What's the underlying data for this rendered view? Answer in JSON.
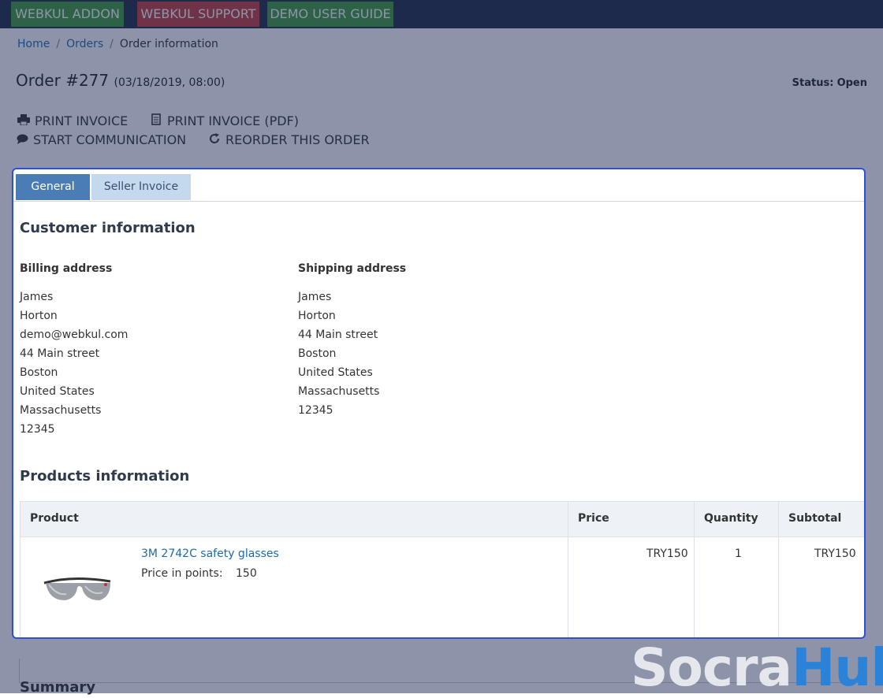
{
  "topbar": {
    "addon_label": "WEBKUL ADDON",
    "support_label": "WEBKUL SUPPORT",
    "guide_label": "DEMO USER GUIDE"
  },
  "breadcrumb": [
    "Home",
    "Orders",
    "Order information"
  ],
  "breadcrumb_sep": "/",
  "order": {
    "title": "Order #277",
    "date": "(03/18/2019, 08:00)",
    "status_label": "Status:",
    "status_value": "Open"
  },
  "actions": {
    "print_invoice": "PRINT INVOICE",
    "print_invoice_pdf": "PRINT INVOICE (PDF)",
    "start_communication": "START COMMUNICATION",
    "reorder": "REORDER THIS ORDER"
  },
  "tabs": [
    "General",
    "Seller Invoice"
  ],
  "customer": {
    "heading": "Customer information",
    "billing_heading": "Billing address",
    "billing": [
      "James",
      "Horton",
      "demo@webkul.com",
      "44 Main street",
      "Boston",
      "United States",
      "Massachusetts",
      "12345"
    ],
    "shipping_heading": "Shipping address",
    "shipping": [
      "James",
      "Horton",
      "44 Main street",
      "Boston",
      "United States",
      "Massachusetts",
      "12345"
    ]
  },
  "products": {
    "heading": "Products information",
    "columns": [
      "Product",
      "Price",
      "Quantity",
      "Subtotal"
    ],
    "rows": [
      {
        "name": "3M 2742C safety glasses",
        "points_label": "Price in points:",
        "points_value": "150",
        "price": "TRY150",
        "quantity": "1",
        "subtotal": "TRY150"
      }
    ]
  },
  "summary_heading": "Summary",
  "watermark": {
    "part1": "Socra",
    "part2": "Hub"
  },
  "colors": {
    "overlay": "#1c2a54",
    "highlight_border": "#2b4fe0",
    "tab_active": "#4a7db5",
    "link": "#1e6aa8"
  }
}
